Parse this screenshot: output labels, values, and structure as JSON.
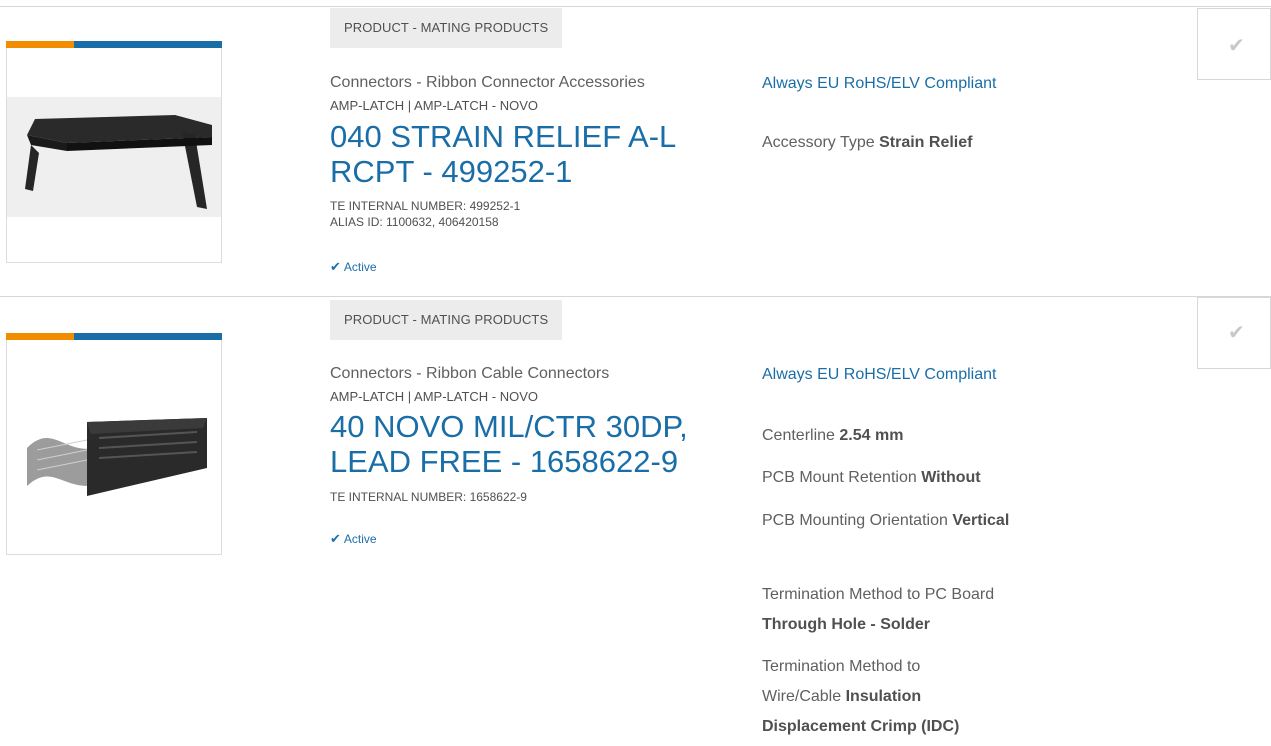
{
  "products": [
    {
      "tag": "PRODUCT - MATING PRODUCTS",
      "category": "Connectors - Ribbon Connector Accessories",
      "series": "AMP-LATCH | AMP-LATCH - NOVO",
      "title": "040 STRAIN RELIEF A-L RCPT - 499252-1",
      "internal_number": "TE INTERNAL NUMBER: 499252-1",
      "alias": "ALIAS ID: 1100632, 406420158",
      "status": "Active",
      "rohs": "Always EU RoHS/ELV Compliant",
      "features": [
        {
          "label": "Accessory Type",
          "value": "Strain Relief"
        }
      ]
    },
    {
      "tag": "PRODUCT - MATING PRODUCTS",
      "category": "Connectors - Ribbon Cable Connectors",
      "series": "AMP-LATCH | AMP-LATCH - NOVO",
      "title": "40 NOVO MIL/CTR 30DP, LEAD FREE - 1658622-9",
      "internal_number": "TE INTERNAL NUMBER: 1658622-9",
      "status": "Active",
      "rohs": "Always EU RoHS/ELV Compliant",
      "features": [
        {
          "label": "Centerline",
          "value": "2.54 mm"
        },
        {
          "label": "PCB Mount Retention",
          "value": "Without"
        },
        {
          "label": "PCB Mounting Orientation",
          "value": "Vertical"
        },
        {
          "label": "Termination Method to PC Board",
          "value": "Through Hole - Solder"
        },
        {
          "label": "Termination Method to Wire/Cable",
          "value": "Insulation Displacement Crimp (IDC)"
        }
      ]
    }
  ],
  "icons": {
    "status": "checkmark-icon",
    "compare": "checkmark-icon"
  },
  "colors": {
    "accent_blue": "#1a6ea8",
    "accent_orange": "#f28d00",
    "tag_bg": "#ececec"
  }
}
